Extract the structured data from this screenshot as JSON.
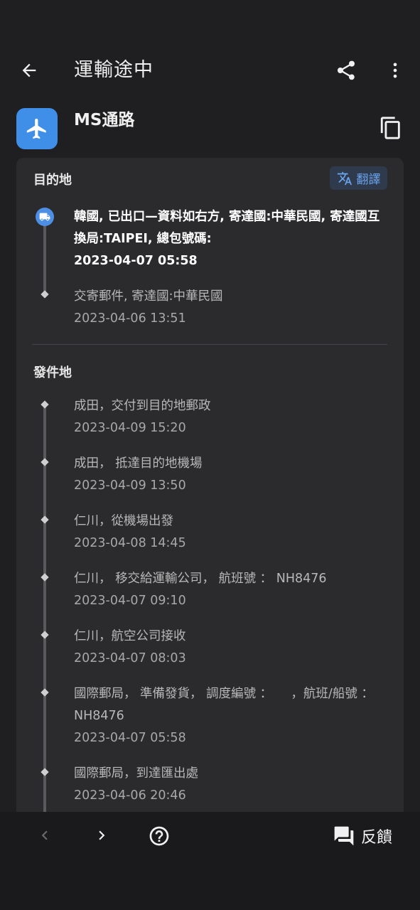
{
  "header": {
    "title": "運輸途中",
    "carrier_name": "MS通路"
  },
  "destination": {
    "section_title": "目的地",
    "translate_label": "翻譯",
    "events": [
      {
        "desc": "韓國, 已出口—資料如右方, 寄達國:中華民國, 寄達國互換局:TAIPEI, 總包號碼:",
        "time": "2023-04-07 05:58"
      },
      {
        "desc": "交寄郵件, 寄達國:中華民國",
        "time": "2023-04-06 13:51"
      }
    ]
  },
  "origin": {
    "section_title": "發件地",
    "events": [
      {
        "desc": "成田，交付到目的地郵政",
        "time": "2023-04-09 15:20"
      },
      {
        "desc": "成田， 抵達目的地機場",
        "time": "2023-04-09 13:50"
      },
      {
        "desc": "仁川，從機場出發",
        "time": "2023-04-08 14:45"
      },
      {
        "desc": "仁川， 移交給運輸公司， 航班號 ： NH8476",
        "time": "2023-04-07 09:10"
      },
      {
        "desc": "仁川，航空公司接收",
        "time": "2023-04-07 08:03"
      },
      {
        "desc": "國際郵局， 準備發貨， 調度編號 ：　　，航班/船號 ： NH8476",
        "time": "2023-04-07 05:58"
      },
      {
        "desc": "國際郵局，到達匯出處",
        "time": "2023-04-06 20:46"
      }
    ]
  },
  "bottom": {
    "feedback_label": "反饋"
  },
  "colors": {
    "background": "#1f1f21",
    "card": "#2b2b2e",
    "accent": "#4e8fe6",
    "carrier_logo": "#3f8fe9"
  }
}
